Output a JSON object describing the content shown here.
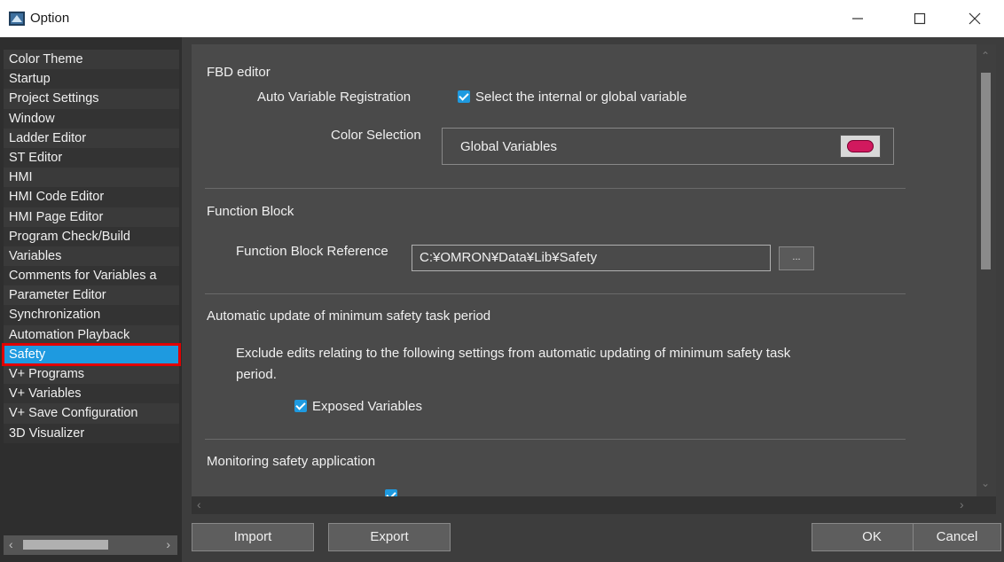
{
  "window": {
    "title": "Option",
    "icon": "app-logo-icon",
    "controls": [
      "minimize-icon",
      "maximize-icon",
      "close-icon"
    ]
  },
  "sidebar": {
    "items": [
      {
        "label": "Color Theme"
      },
      {
        "label": "Startup"
      },
      {
        "label": "Project Settings"
      },
      {
        "label": "Window"
      },
      {
        "label": "Ladder Editor"
      },
      {
        "label": "ST Editor"
      },
      {
        "label": "HMI"
      },
      {
        "label": "HMI Code Editor"
      },
      {
        "label": "HMI Page Editor"
      },
      {
        "label": "Program Check/Build"
      },
      {
        "label": "Variables"
      },
      {
        "label": "Comments for Variables a"
      },
      {
        "label": "Parameter Editor"
      },
      {
        "label": "Synchronization"
      },
      {
        "label": "Automation Playback"
      },
      {
        "label": "Safety"
      },
      {
        "label": "V+ Programs"
      },
      {
        "label": "V+ Variables"
      },
      {
        "label": "V+ Save Configuration"
      },
      {
        "label": "3D Visualizer"
      }
    ],
    "selected": "Safety"
  },
  "fbd": {
    "section_title": "FBD editor",
    "auto_var_label": "Auto Variable Registration",
    "auto_var_checkbox": "Select the internal or global variable",
    "auto_var_checked": true,
    "color_label": "Color Selection",
    "color_value": "Global Variables",
    "color_swatch": "#d1195e"
  },
  "function_block": {
    "section_title": "Function Block",
    "ref_label": "Function Block Reference",
    "ref_value": "C:¥OMRON¥Data¥Lib¥Safety",
    "browse_label": "..."
  },
  "auto_update": {
    "section_title": "Automatic update of minimum safety task period",
    "description_line1": "Exclude edits relating to the following settings from automatic updating of minimum safety task",
    "description_line2": "period.",
    "exposed_label": "Exposed Variables",
    "exposed_checked": true
  },
  "monitoring": {
    "section_title": "Monitoring safety application"
  },
  "buttons": {
    "import": "Import",
    "export": "Export",
    "ok": "OK",
    "cancel": "Cancel"
  },
  "colors": {
    "accent": "#1e9ae0",
    "highlight": "#e00000"
  }
}
